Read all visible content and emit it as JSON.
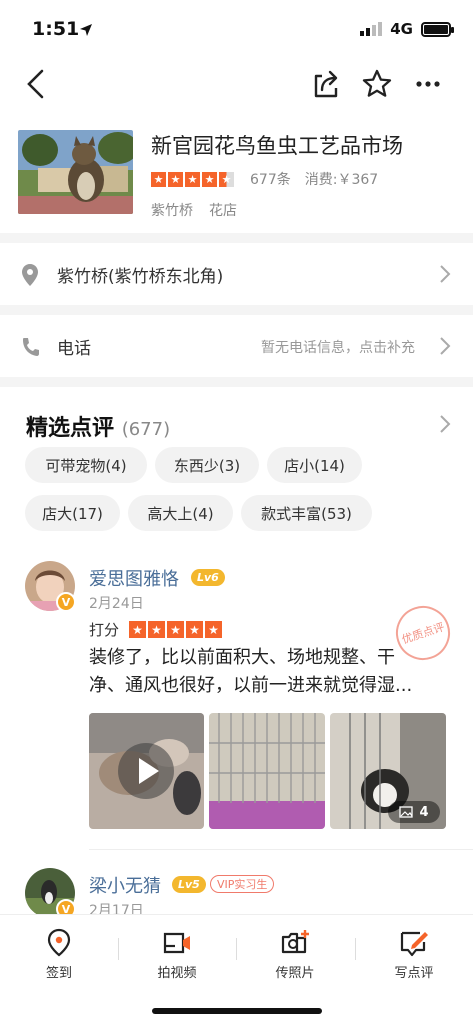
{
  "status": {
    "time": "1:51",
    "network": "4G"
  },
  "shop": {
    "name": "新官园花鸟鱼虫工艺品市场",
    "rating": 4.5,
    "review_count": "677条",
    "cost": "消费:￥367",
    "district": "紫竹桥",
    "category": "花店"
  },
  "address": {
    "text": "紫竹桥(紫竹桥东北角)"
  },
  "phone": {
    "label": "电话",
    "hint": "暂无电话信息，点击补充"
  },
  "reviews_section": {
    "title": "精选点评",
    "count": "(677)",
    "tags": [
      "可带宠物(4)",
      "东西少(3)",
      "店小(14)",
      "店大(17)",
      "高大上(4)",
      "款式丰富(53)"
    ]
  },
  "reviews": [
    {
      "user": "爱思图雅恪",
      "level": "Lv6",
      "date": "2月24日",
      "score_label": "打分",
      "stars": 5,
      "text_line1": "装修了，比以前面积大、场地规整、干",
      "text_line2": "净、通风也很好，以前一进来就觉得湿...",
      "stamp": "优质点评",
      "photo_count": "4"
    },
    {
      "user": "梁小无猜",
      "level": "Lv5",
      "badge": "VIP实习生",
      "date": "2月17日"
    }
  ],
  "bottom_tabs": [
    "签到",
    "拍视频",
    "传照片",
    "写点评"
  ],
  "colors": {
    "accent": "#f5642a",
    "username": "#4a6e98"
  }
}
